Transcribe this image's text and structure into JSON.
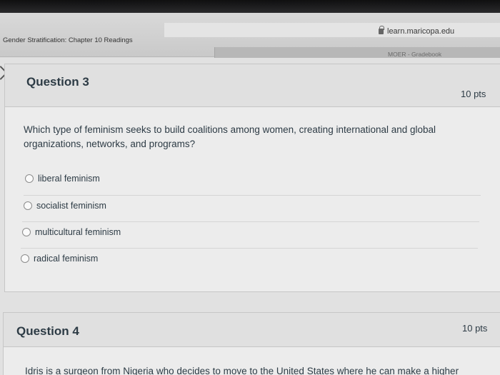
{
  "browser": {
    "url": "learn.maricopa.edu",
    "tab_title": "Gender Stratification: Chapter 10 Readings",
    "tab_right": "MOER - Gradebook"
  },
  "question3": {
    "title": "Question 3",
    "points": "10 pts",
    "text_line1": "Which type of feminism seeks to build coalitions among women, creating international and global",
    "text_line2": "organizations, networks, and programs?",
    "answers": [
      "liberal feminism",
      "socialist feminism",
      "multicultural feminism",
      "radical feminism"
    ]
  },
  "question4": {
    "title": "Question 4",
    "points": "10 pts",
    "text_partial": "Idris is a surgeon from Nigeria who decides to move to the United States where he can make a higher"
  },
  "icons": {
    "lock": "lock-icon",
    "back": "chevron-left-icon"
  }
}
